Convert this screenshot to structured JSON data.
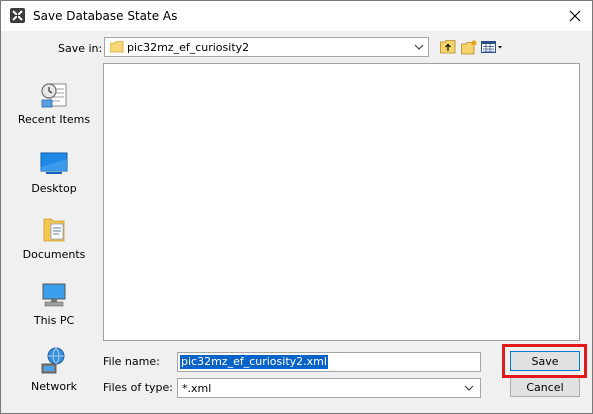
{
  "window": {
    "title": "Save Database State As"
  },
  "save_in": {
    "label": "Save in:",
    "folder": "pic32mz_ef_curiosity2"
  },
  "places": [
    {
      "label": "Recent Items",
      "icon": "recent-items-icon"
    },
    {
      "label": "Desktop",
      "icon": "desktop-icon"
    },
    {
      "label": "Documents",
      "icon": "documents-icon"
    },
    {
      "label": "This PC",
      "icon": "this-pc-icon"
    },
    {
      "label": "Network",
      "icon": "network-icon"
    }
  ],
  "file_name": {
    "label": "File name:",
    "value": "pic32mz_ef_curiosity2.xml"
  },
  "file_type": {
    "label": "Files of type:",
    "value": "*.xml"
  },
  "buttons": {
    "save": "Save",
    "cancel": "Cancel"
  },
  "colors": {
    "selection": "#0a63c9",
    "highlight": "#e21a1a",
    "save_border": "#0078d7"
  }
}
